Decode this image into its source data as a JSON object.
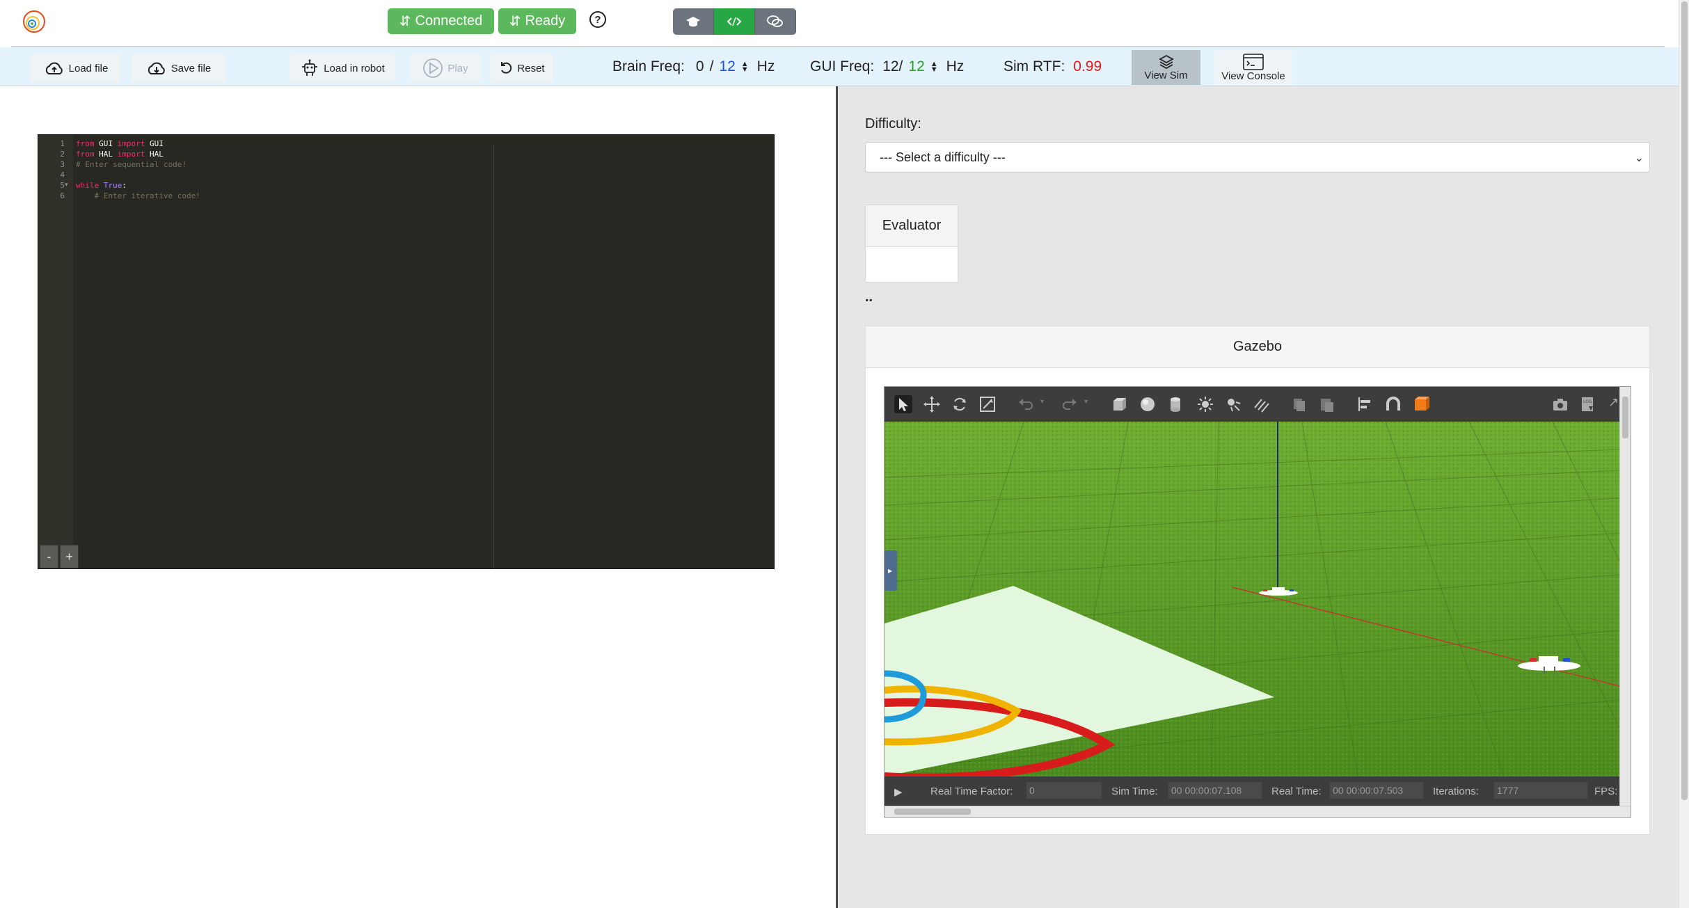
{
  "topbar": {
    "connected_label": "Connected",
    "ready_label": "Ready",
    "help_label": "?"
  },
  "toolbar": {
    "load_file": "Load file",
    "save_file": "Save file",
    "load_in_robot": "Load in robot",
    "play": "Play",
    "reset": "Reset",
    "brain_freq_label": "Brain Freq:",
    "brain_freq_current": "0",
    "brain_freq_sep": "/",
    "brain_freq_target": "12",
    "brain_freq_unit": "Hz",
    "gui_freq_label": "GUI Freq:",
    "gui_freq_current": "12/",
    "gui_freq_target": "12",
    "gui_freq_unit": "Hz",
    "sim_rtf_label": "Sim RTF:",
    "sim_rtf_value": "0.99",
    "view_sim": "View Sim",
    "view_console": "View Console"
  },
  "editor": {
    "line_numbers": [
      "1",
      "2",
      "3",
      "4",
      "5",
      "6"
    ],
    "lines": [
      {
        "kw1": "from",
        "t1": " GUI ",
        "kw2": "import",
        "t2": " GUI"
      },
      {
        "kw1": "from",
        "t1": " HAL ",
        "kw2": "import",
        "t2": " HAL"
      },
      {
        "comment": "# Enter sequential code!"
      },
      {},
      {
        "kw1": "while",
        "t1": " ",
        "kw3": "True",
        "t2": ":"
      },
      {
        "comment": "    # Enter iterative code!"
      }
    ],
    "zoom_out": "-",
    "zoom_in": "+"
  },
  "exercise": {
    "difficulty_label": "Difficulty:",
    "difficulty_selected": "--- Select a difficulty ---",
    "evaluator_title": "Evaluator",
    "evaluator_dots": "..",
    "gazebo_title": "Gazebo"
  },
  "gazebo": {
    "real_time_factor_label": "Real Time Factor:",
    "real_time_factor_value": "0",
    "sim_time_label": "Sim Time:",
    "sim_time_value": "00 00:00:07.108",
    "real_time_label": "Real Time:",
    "real_time_value": "00 00:00:07.503",
    "iterations_label": "Iterations:",
    "iterations_value": "1777",
    "fps_label": "FPS:"
  },
  "colors": {
    "green": "#5cb85c",
    "active_mode": "#28a745",
    "rtf_red": "#e01818",
    "freq_blue": "#1e52d6"
  }
}
